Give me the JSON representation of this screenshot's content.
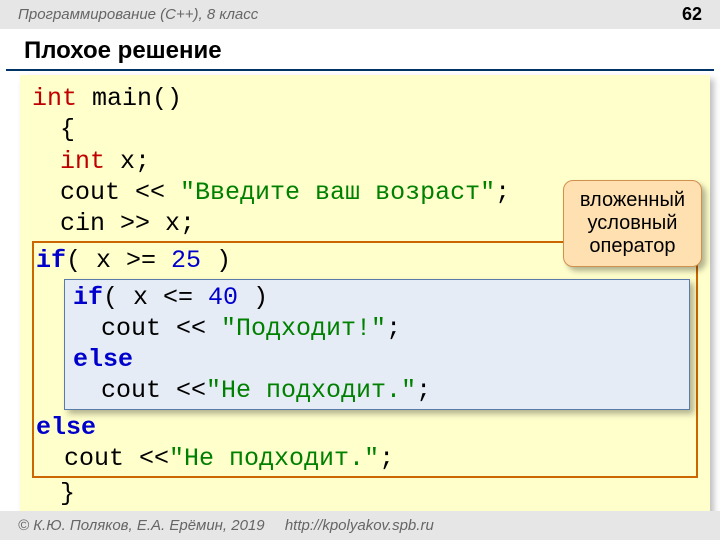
{
  "header": {
    "course": "Программирование (C++), 8 класс",
    "page": "62"
  },
  "title": "Плохое решение",
  "code": {
    "l1_type": "int",
    "l1_rest": " main()",
    "l2": "{",
    "l3_type": "int",
    "l3_rest": " x;",
    "l4_a": "cout ",
    "l4_op": "<<",
    "l4_str": " \"Введите ваш возраст\"",
    "l4_end": ";",
    "l5_a": "cin ",
    "l5_op": ">>",
    "l5_rest": " x;",
    "outer": {
      "if_kw": "if",
      "if_cond_a": "( x ",
      "if_op": ">=",
      "if_num": " 25",
      "if_cond_b": " )",
      "else_kw": "else",
      "else_body_a": "cout ",
      "else_body_op": "<<",
      "else_body_str": "\"Не подходит.\"",
      "else_body_end": ";"
    },
    "inner": {
      "if_kw": "if",
      "if_cond_a": "( x ",
      "if_op": "<=",
      "if_num": " 40",
      "if_cond_b": " )",
      "then_a": "cout ",
      "then_op": "<<",
      "then_str": " \"Подходит!\"",
      "then_end": ";",
      "else_kw": "else",
      "else_a": "cout ",
      "else_op": "<<",
      "else_str": "\"Не подходит.\"",
      "else_end": ";"
    },
    "last": "}"
  },
  "callout": {
    "line1": "вложенный",
    "line2": "условный",
    "line3": "оператор"
  },
  "footer": {
    "copyright": "© К.Ю. Поляков, Е.А. Ерёмин, 2019",
    "url": "http://kpolyakov.spb.ru"
  }
}
